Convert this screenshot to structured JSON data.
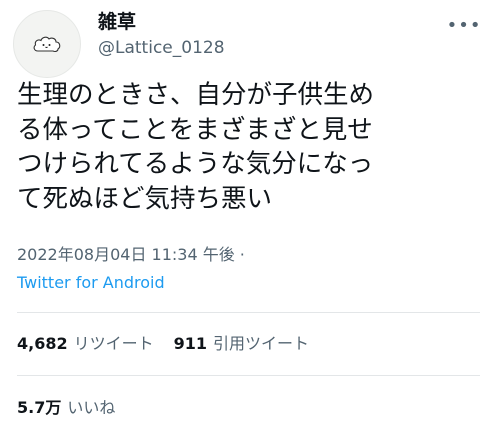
{
  "author": {
    "name": "雑草",
    "handle": "@Lattice_0128",
    "avatar_icon": "cloud-face-icon"
  },
  "more_icon": "more-horizontal-icon",
  "tweet": {
    "text": "生理のときさ、自分が子供生め\nる体ってことをまざまざと見せ\nつけられてるような気分になっ\nて死ぬほど気持ち悪い",
    "timestamp": "2022年08月04日 11:34 午後 ·",
    "source": "Twitter for Android"
  },
  "stats": {
    "retweets_count": "4,682",
    "retweets_label": "リツイート",
    "quotes_count": "911",
    "quotes_label": "引用ツイート",
    "likes_count": "5.7万",
    "likes_label": "いいね"
  },
  "colors": {
    "link": "#1d9bf0",
    "secondary_text": "#536471",
    "divider": "#e3e6e8"
  }
}
